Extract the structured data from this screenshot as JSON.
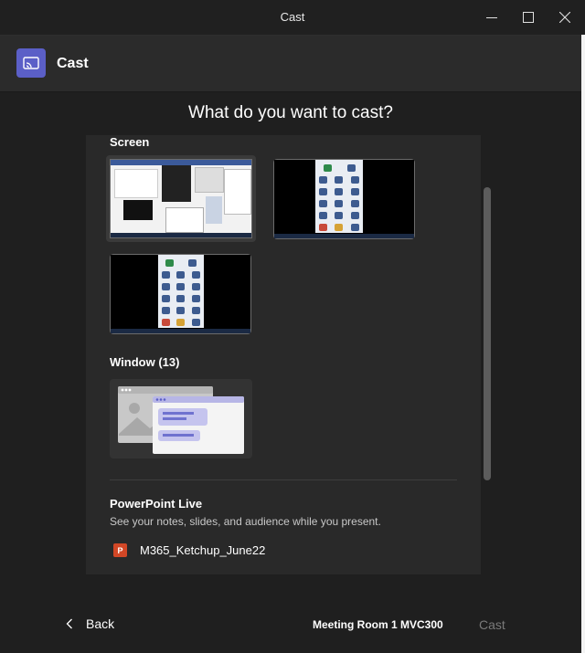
{
  "window": {
    "title": "Cast",
    "controls": [
      "minimize-icon",
      "maximize-icon",
      "close-icon"
    ]
  },
  "header": {
    "icon": "cast-icon",
    "title": "Cast",
    "accent_color": "#5b5fc7"
  },
  "main": {
    "heading": "What do you want to cast?"
  },
  "screen_section": {
    "title": "Screen",
    "thumbnails": [
      {
        "name": "screen-1",
        "selected": true
      },
      {
        "name": "screen-2",
        "selected": false
      },
      {
        "name": "screen-3",
        "selected": false
      }
    ]
  },
  "window_section": {
    "title": "Window (13)"
  },
  "powerpoint_section": {
    "title": "PowerPoint Live",
    "description": "See your notes, slides, and audience while you present.",
    "files": [
      {
        "icon": "powerpoint-icon",
        "name": "M365_Ketchup_June22"
      }
    ]
  },
  "footer": {
    "back_label": "Back",
    "device": "Meeting Room 1 MVC300",
    "cast_label": "Cast"
  }
}
